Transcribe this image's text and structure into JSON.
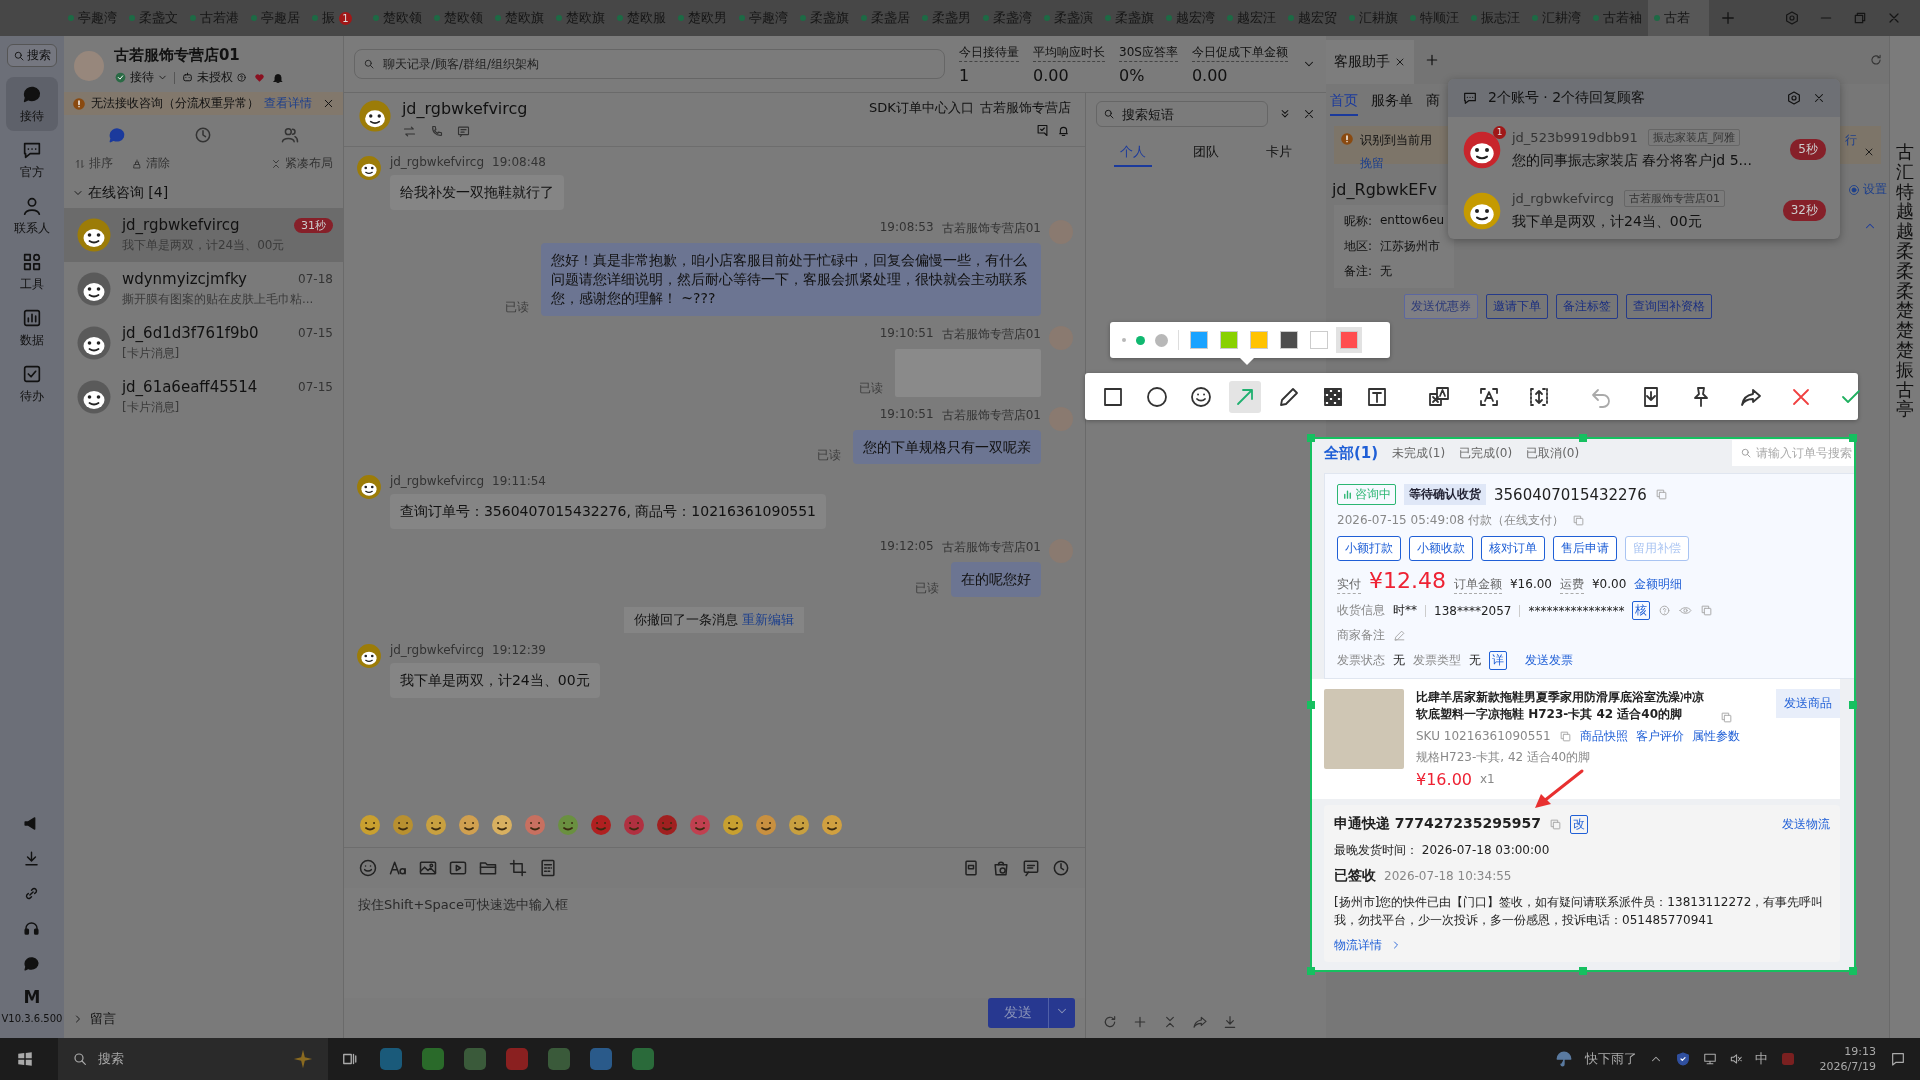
{
  "top_tabs": [
    {
      "label": "亭趣湾",
      "selected": false
    },
    {
      "label": "柔盏文",
      "selected": false
    },
    {
      "label": "古若港",
      "selected": false
    },
    {
      "label": "亭趣居",
      "selected": false
    },
    {
      "label": "振",
      "selected": false,
      "badge": "1"
    },
    {
      "label": "楚欧领",
      "selected": false
    },
    {
      "label": "楚欧领",
      "selected": false
    },
    {
      "label": "楚欧旗",
      "selected": false
    },
    {
      "label": "楚欧旗",
      "selected": false
    },
    {
      "label": "楚欧服",
      "selected": false
    },
    {
      "label": "楚欧男",
      "selected": false
    },
    {
      "label": "亭趣湾",
      "selected": false
    },
    {
      "label": "柔盏旗",
      "selected": false
    },
    {
      "label": "柔盏居",
      "selected": false
    },
    {
      "label": "柔盏男",
      "selected": false
    },
    {
      "label": "柔盏湾",
      "selected": false
    },
    {
      "label": "柔盏演",
      "selected": false
    },
    {
      "label": "柔盏旗",
      "selected": false
    },
    {
      "label": "越宏湾",
      "selected": false
    },
    {
      "label": "越宏汪",
      "selected": false
    },
    {
      "label": "越宏贸",
      "selected": false
    },
    {
      "label": "汇耕旗",
      "selected": false
    },
    {
      "label": "特顺汪",
      "selected": false
    },
    {
      "label": "振志汪",
      "selected": false
    },
    {
      "label": "汇耕湾",
      "selected": false
    },
    {
      "label": "古若袖",
      "selected": false
    },
    {
      "label": "古若",
      "selected": true
    }
  ],
  "side_nav": {
    "search": "搜索",
    "items": [
      {
        "label": "接待",
        "selected": true
      },
      {
        "label": "官方",
        "selected": false
      },
      {
        "label": "联系人",
        "selected": false
      },
      {
        "label": "工具",
        "selected": false
      },
      {
        "label": "数据",
        "selected": false
      },
      {
        "label": "待办",
        "selected": false
      }
    ],
    "letter": "M",
    "version": "V10.3.6.500"
  },
  "conversations": {
    "shop": "古若服饰专营店01",
    "status": "接待",
    "auth": "未授权",
    "alert": {
      "text": "无法接收咨询（分流权重异常）",
      "link": "查看详情"
    },
    "views": [
      {
        "selected": true
      },
      {
        "selected": false
      },
      {
        "selected": false
      }
    ],
    "actions": [
      "排序",
      "清除",
      "紧凑布局"
    ],
    "group": {
      "label": "在线咨询 [4]",
      "expanded": true
    },
    "items": [
      {
        "name": "jd_rgbwkefvircg",
        "preview": "我下单是两双，计24当、00元",
        "badge": "31秒",
        "selected": true
      },
      {
        "name": "wdynmyizcjmfky",
        "preview": "撕开膜有图案的贴在皮肤上毛巾粘...",
        "time": "07-18",
        "selected": false
      },
      {
        "name": "jd_6d1d3f761f9b0",
        "preview": "[卡片消息]",
        "time": "07-15",
        "selected": false
      },
      {
        "name": "jd_61a6eaff45514",
        "preview": "[卡片消息]",
        "time": "07-15",
        "selected": false
      }
    ],
    "footer": "留言"
  },
  "top_strip": {
    "search_placeholder": "聊天记录/顾客/群组/组织架构",
    "stats": [
      {
        "label": "今日接待量",
        "value": "1"
      },
      {
        "label": "平均响应时长",
        "value": "0.00"
      },
      {
        "label": "30S应答率",
        "value": "0%"
      },
      {
        "label": "今日促成下单金额",
        "value": "0.00"
      }
    ]
  },
  "chat": {
    "name": "jd_rgbwkefvircg",
    "links": [
      "SDK订单中心入口",
      "古若服饰专营店"
    ],
    "messages": [
      {
        "kind": "in",
        "sender": "jd_rgbwkefvircg",
        "time": "19:08:48",
        "text": "给我补发一双拖鞋就行了"
      },
      {
        "kind": "out",
        "sender": "古若服饰专营店01",
        "time": "19:08:53",
        "text": "您好！真是非常抱歉，咱小店客服目前处于忙碌中，回复会偏慢一些，有什么问题请您详细说明，然后耐心等待一下，客服会抓紧处理，很快就会主动联系您，感谢您的理解！ ~???",
        "status": "已读"
      },
      {
        "kind": "image",
        "sender": "古若服饰专营店01",
        "time": "19:10:51",
        "status": "已读"
      },
      {
        "kind": "out",
        "sender": "古若服饰专营店01",
        "time": "19:10:51",
        "text": "您的下单规格只有一双呢亲",
        "status": "已读"
      },
      {
        "kind": "in",
        "sender": "jd_rgbwkefvircg",
        "time": "19:11:54",
        "text": "查询订单号：3560407015432276, 商品号：10216361090551"
      },
      {
        "kind": "out",
        "sender": "古若服饰专营店01",
        "time": "19:12:05",
        "text": "在的呢您好",
        "status": "已读"
      },
      {
        "kind": "recall",
        "text": "你撤回了一条消息",
        "link": "重新编辑"
      },
      {
        "kind": "in",
        "sender": "jd_rgbwkefvircg",
        "time": "19:12:39",
        "text": "我下单是两双，计24当、00元"
      }
    ],
    "input_placeholder": "按住Shift+Space可快速选中输入框",
    "send": "发送"
  },
  "phrases": {
    "search_placeholder": "搜索短语",
    "tabs": [
      {
        "label": "个人",
        "selected": true
      },
      {
        "label": "团队",
        "selected": false
      },
      {
        "label": "卡片",
        "selected": false
      }
    ]
  },
  "assistant": {
    "tab": "客服助手",
    "subtabs": [
      {
        "label": "首页",
        "selected": true
      },
      {
        "label": "服务单",
        "selected": false
      },
      {
        "label": "商",
        "selected": false
      }
    ],
    "alert": "识别到当前用",
    "alert_link": "挽留",
    "alert_tail": "行",
    "customer": "jd_RgbwkEFv",
    "setting": "设置",
    "setting_selected": true,
    "fields": [
      {
        "label": "昵称:",
        "value": "enttow6eu"
      },
      {
        "label": "地区:",
        "value": "江苏扬州市"
      },
      {
        "label": "备注:",
        "value": "无"
      }
    ],
    "buttons": [
      {
        "label": "发送优惠券",
        "disabled": true
      },
      {
        "label": "邀请下单",
        "disabled": false
      },
      {
        "label": "备注标签",
        "disabled": false
      },
      {
        "label": "查询国补资格",
        "disabled": false
      }
    ],
    "edge_tabs": "古汇特越越柔柔柔楚楚楚振古亭"
  },
  "notification": {
    "title": "2个账号 · 2个待回复顾客",
    "items": [
      {
        "name": "jd_523b9919dbb91",
        "shop": "振志家装店_阿雅",
        "text": "您的同事振志家装店 春分将客户jd 5...",
        "wait": "5秒",
        "unread": "1",
        "color": "#c8252c"
      },
      {
        "name": "jd_rgbwkefvircg",
        "shop": "古若服饰专营店01",
        "text": "我下单是两双，计24当、00元",
        "wait": "32秒",
        "color": "#c59a00"
      }
    ]
  },
  "snip_toolbar": {
    "sizes": [
      {
        "selected": false
      },
      {
        "selected": true
      },
      {
        "selected": false
      }
    ],
    "colors": [
      {
        "color": "#1aa3ff",
        "selected": false
      },
      {
        "color": "#88d100",
        "selected": false
      },
      {
        "color": "#ffc300",
        "selected": false
      },
      {
        "color": "#4d4d4d",
        "selected": false
      },
      {
        "color": "#ffffff",
        "selected": false
      },
      {
        "color": "#ff4d4f",
        "selected": true
      }
    ],
    "tools": [
      {
        "selected": false
      },
      {
        "selected": false
      },
      {
        "selected": false
      },
      {
        "selected": true
      },
      {
        "selected": false
      },
      {
        "selected": false
      },
      {
        "selected": false
      },
      {
        "selected": false
      },
      {
        "selected": false
      },
      {
        "selected": false
      },
      {
        "selected": false
      },
      {
        "selected": false
      },
      {
        "selected": false
      },
      {
        "selected": false
      },
      {
        "selected": false
      },
      {
        "selected": false
      }
    ]
  },
  "orders": {
    "tabs": [
      {
        "label": "全部(1)",
        "selected": true
      },
      {
        "label": "未完成(1)",
        "selected": false
      },
      {
        "label": "已完成(0)",
        "selected": false
      },
      {
        "label": "已取消(0)",
        "selected": false
      }
    ],
    "search_placeholder": "请输入订单号搜索",
    "tags": [
      "咨询中",
      "等待确认收货"
    ],
    "order_no": "3560407015432276",
    "paid_time": "2026-07-15 05:49:08  付款（在线支付）",
    "buttons": [
      {
        "label": "小额打款",
        "disabled": false
      },
      {
        "label": "小额收款",
        "disabled": false
      },
      {
        "label": "核对订单",
        "disabled": false
      },
      {
        "label": "售后申请",
        "disabled": false
      },
      {
        "label": "留用补偿",
        "disabled": true
      }
    ],
    "paid_label": "实付",
    "paid": "¥12.48",
    "amount_label": "订单金额",
    "amount": "¥16.00",
    "freight_label": "运费",
    "freight": "¥0.00",
    "detail_link": "金额明细",
    "receiver_label": "收货信息",
    "receiver": "时**",
    "phone": "138****2057",
    "address": "****************",
    "verify": "核",
    "note_label": "商家备注",
    "invoice": [
      {
        "label": "发票状态",
        "value": "无"
      },
      {
        "label": "发票类型",
        "value": "无"
      }
    ],
    "invoice_detail": "详",
    "invoice_send": "发送发票",
    "product": {
      "title": "比肆羊居家新款拖鞋男夏季家用防滑厚底浴室洗澡冲凉软底塑料一字凉拖鞋 H723-卡其 42 适合40的脚",
      "sku": "SKU 10216361090551",
      "links": [
        "商品快照",
        "客户评价",
        "属性参数"
      ],
      "spec": "规格H723-卡其, 42 适合40的脚",
      "price": "¥16.00",
      "qty": "x1",
      "send": "发送商品"
    },
    "shipping": {
      "carrier": "申通快递 777427235295957",
      "edit": "改",
      "send": "发送物流",
      "deadline": "最晚发货时间：  2026-07-18 03:00:00",
      "state": "已签收",
      "state_time": "2026-07-18 10:34:55",
      "detail": "[扬州市]您的快件已由【门口】签收，如有疑问请联系派件员：13813112272，有事先呼叫我，勿找平台，少一次投诉，多一份感恩，投诉电话：051485770941",
      "link": "物流详情"
    }
  },
  "taskbar": {
    "search": "搜索",
    "weather": "快下雨了",
    "ime": "中",
    "time": "19:13",
    "date": "2026/7/19"
  }
}
